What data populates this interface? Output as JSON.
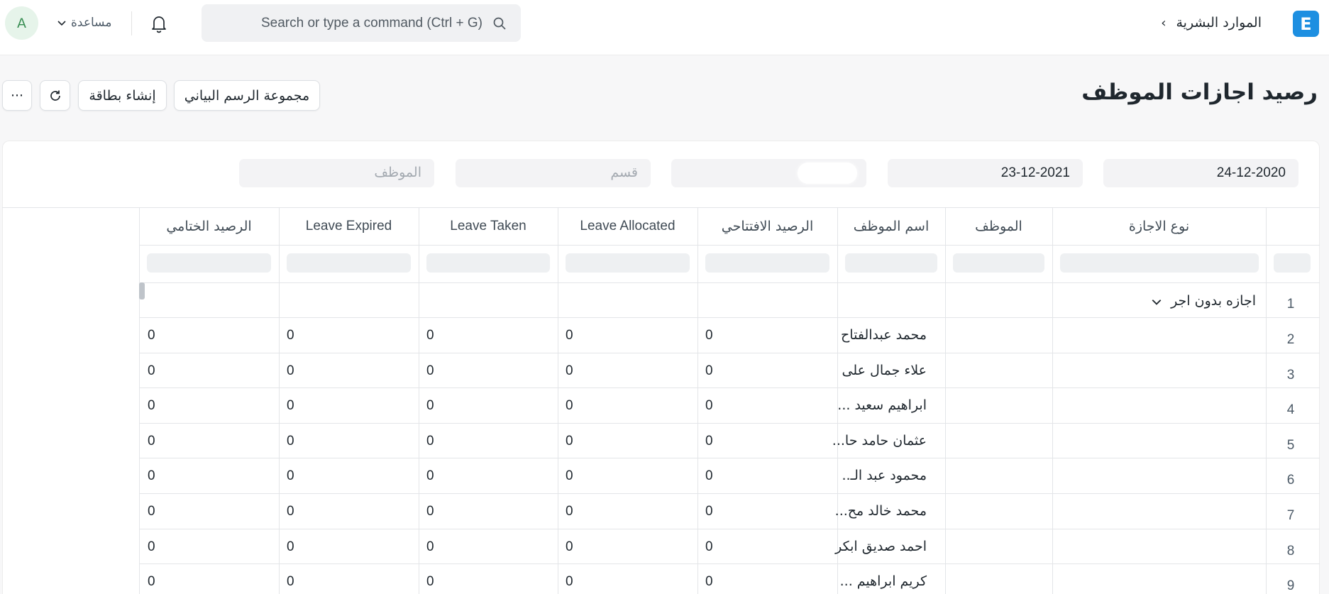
{
  "navbar": {
    "avatar_letter": "A",
    "help_label": "مساعدة",
    "search_placeholder": "Search or type a command (Ctrl + G)",
    "breadcrumb_chevron": "›",
    "breadcrumb_module": "الموارد البشرية",
    "app_logo_letter": "E"
  },
  "page": {
    "title": "رصيد اجازات الموظف",
    "buttons": {
      "more": "···",
      "card": "إنشاء بطاقة",
      "chart_group": "مجموعة الرسم البياني"
    }
  },
  "filters": {
    "from_date": "24-12-2020",
    "to_date": "23-12-2021",
    "department_placeholder": "قسم",
    "employee_placeholder": "الموظف"
  },
  "table": {
    "columns": [
      "نوع الاجازة",
      "الموظف",
      "اسم الموظف",
      "الرصيد الافتتاحي",
      "Leave Allocated",
      "Leave Taken",
      "Leave Expired",
      "الرصيد الختامي"
    ],
    "group_row": {
      "row_number": "1",
      "leave_type": "اجازه بدون اجر"
    },
    "rows": [
      {
        "n": "2",
        "name": "محمد عبدالفتاح",
        "opening": "0",
        "allocated": "0",
        "taken": "0",
        "expired": "0",
        "closing": "0"
      },
      {
        "n": "3",
        "name": "علاء جمال على",
        "opening": "0",
        "allocated": "0",
        "taken": "0",
        "expired": "0",
        "closing": "0"
      },
      {
        "n": "4",
        "name": "ابراهيم سعيد ...",
        "opening": "0",
        "allocated": "0",
        "taken": "0",
        "expired": "0",
        "closing": "0"
      },
      {
        "n": "5",
        "name": "عثمان حامد حا...",
        "opening": "0",
        "allocated": "0",
        "taken": "0",
        "expired": "0",
        "closing": "0"
      },
      {
        "n": "6",
        "name": "محمود عبد الـ..",
        "opening": "0",
        "allocated": "0",
        "taken": "0",
        "expired": "0",
        "closing": "0"
      },
      {
        "n": "7",
        "name": "محمد خالد مح...",
        "opening": "0",
        "allocated": "0",
        "taken": "0",
        "expired": "0",
        "closing": "0"
      },
      {
        "n": "8",
        "name": "احمد صديق ابكر",
        "opening": "0",
        "allocated": "0",
        "taken": "0",
        "expired": "0",
        "closing": "0"
      },
      {
        "n": "9",
        "name": "كريم ابراهيم ...",
        "opening": "0",
        "allocated": "0",
        "taken": "0",
        "expired": "0",
        "closing": "0"
      }
    ]
  },
  "colors": {
    "accent": "#1d8fe1",
    "avatar_bg": "#e6f4ea",
    "avatar_text": "#3b8f55",
    "page_bg": "#f7f7f8",
    "filter_bg": "#f3f3f5"
  },
  "icons": {
    "help_caret": "chevron-down-icon",
    "bell": "bell-icon",
    "search": "search-icon",
    "refresh": "refresh-icon",
    "group_caret": "chevron-down-icon"
  }
}
